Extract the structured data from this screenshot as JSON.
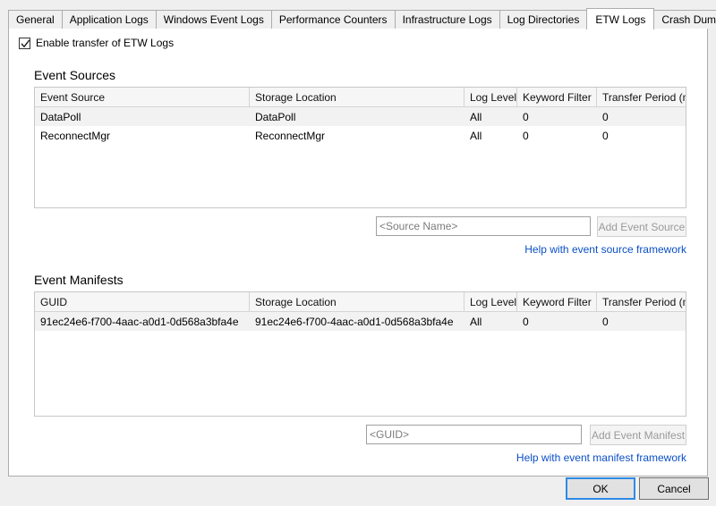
{
  "tabs": [
    {
      "label": "General",
      "selected": false
    },
    {
      "label": "Application Logs",
      "selected": false
    },
    {
      "label": "Windows Event Logs",
      "selected": false
    },
    {
      "label": "Performance Counters",
      "selected": false
    },
    {
      "label": "Infrastructure Logs",
      "selected": false
    },
    {
      "label": "Log Directories",
      "selected": false
    },
    {
      "label": "ETW Logs",
      "selected": true
    },
    {
      "label": "Crash Dumps",
      "selected": false
    }
  ],
  "enable_checkbox": {
    "label": "Enable transfer of ETW Logs",
    "checked": true,
    "icon": "checkmark-icon"
  },
  "event_sources": {
    "title": "Event Sources",
    "columns": [
      "Event Source",
      "Storage Location",
      "Log Level",
      "Keyword Filter",
      "Transfer Period (min)"
    ],
    "rows": [
      [
        "DataPoll",
        "DataPoll",
        "All",
        "0",
        "0"
      ],
      [
        "ReconnectMgr",
        "ReconnectMgr",
        "All",
        "0",
        "0"
      ]
    ],
    "input": {
      "value": "",
      "placeholder": "<Source Name>"
    },
    "add_button": {
      "label": "Add Event Source",
      "enabled": false
    },
    "help_link": "Help with event source framework"
  },
  "event_manifests": {
    "title": "Event Manifests",
    "columns": [
      "GUID",
      "Storage Location",
      "Log Level",
      "Keyword Filter",
      "Transfer Period (min)"
    ],
    "rows": [
      [
        "91ec24e6-f700-4aac-a0d1-0d568a3bfa4e",
        "91ec24e6-f700-4aac-a0d1-0d568a3bfa4e",
        "All",
        "0",
        "0"
      ]
    ],
    "input": {
      "value": "",
      "placeholder": "<GUID>"
    },
    "add_button": {
      "label": "Add Event Manifest",
      "enabled": false
    },
    "help_link": "Help with event manifest framework"
  },
  "footer": {
    "ok_label": "OK",
    "cancel_label": "Cancel"
  },
  "colors": {
    "accent": "#2e8ae6",
    "link": "#0a4fc6",
    "panel_bg": "#ffffff",
    "window_bg": "#efefef",
    "border": "#acacac"
  }
}
